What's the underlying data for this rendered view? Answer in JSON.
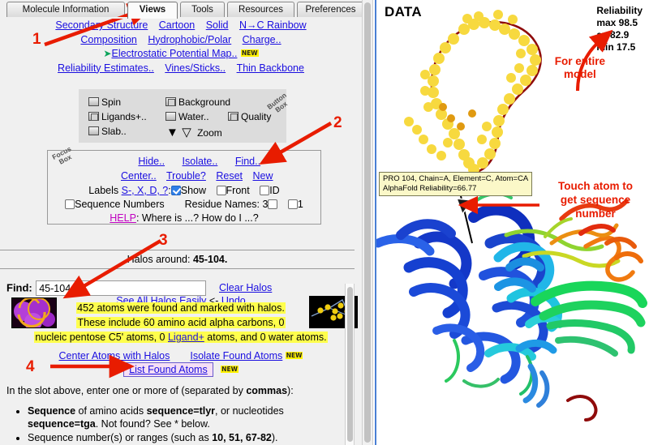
{
  "tabs": [
    {
      "label": "Molecule Information",
      "active": false
    },
    {
      "label": "Views",
      "active": true
    },
    {
      "label": "Tools",
      "active": false
    },
    {
      "label": "Resources",
      "active": false
    },
    {
      "label": "Preferences",
      "active": false
    }
  ],
  "views_links": {
    "row1": [
      "Secondary Structure",
      "Cartoon",
      "Solid",
      "N→C Rainbow"
    ],
    "row2": [
      "Composition",
      "Hydrophobic/Polar",
      "Charge.."
    ],
    "row3_marker": "➤",
    "row3": "Electrostatic Potential Map..",
    "row3_badge": "NEW",
    "row4": [
      "Reliability Estimates..",
      "Vines/Sticks..",
      "Thin Backbone"
    ]
  },
  "button_box": {
    "title": "Button Box",
    "items": [
      {
        "label": "Spin",
        "state": "raised"
      },
      {
        "label": "Background",
        "state": "sunken"
      },
      {
        "label": "Ligands+..",
        "state": "sunken"
      },
      {
        "label": "Water..",
        "state": "raised"
      },
      {
        "label": "Quality",
        "state": "sunken"
      },
      {
        "label": "Slab..",
        "state": "raised"
      },
      {
        "label": "Zoom",
        "state": "arrows"
      }
    ],
    "zoom_label": "Zoom"
  },
  "focus_box": {
    "title": "Focus Box",
    "row1": [
      "Hide..",
      "Isolate..",
      "Find.."
    ],
    "row2": [
      "Center..",
      "Trouble?",
      "Reset",
      "New"
    ],
    "labels_prefix": "Labels ",
    "labels_links": "S-, X, D, ?",
    "labels_colon": ":",
    "show": "Show",
    "show_checked": true,
    "front": "Front",
    "front_checked": false,
    "id": "ID",
    "id_checked": false,
    "sequence_numbers": "Sequence Numbers",
    "sequence_numbers_checked": false,
    "residue_names": "Residue Names: 3",
    "residue_one": "1",
    "help_word": "HELP",
    "help_rest": ": Where is ...? How do I ...?"
  },
  "halos_bar": {
    "prefix": "Halos around: ",
    "value": "45-104."
  },
  "find": {
    "label": "Find:",
    "value": "45-104",
    "placeholder": "",
    "clear_halos": "Clear Halos",
    "see_all": "See All Halos Easily",
    "arrow": " <- ",
    "undo": "Undo"
  },
  "results": {
    "line1": "452 atoms were found and marked with halos.",
    "line2": "These include 60 amino acid alpha carbons, 0",
    "line3_a": "nucleic pentose C5' atoms, 0 ",
    "line3_link": "Ligand+",
    "line3_b": " atoms, and 0 water atoms.",
    "center_atoms": "Center Atoms with Halos",
    "isolate_found": "Isolate Found Atoms",
    "isolate_badge": "NEW",
    "list_found": "List Found Atoms",
    "list_badge": "NEW"
  },
  "instructions": {
    "intro_a": "In the slot above, enter one or more of (separated by ",
    "intro_bold": "commas",
    "intro_b": "):",
    "bullet1_a": "Sequence",
    "bullet1_b": " of amino acids ",
    "bullet1_c": "sequence=tlyr",
    "bullet1_d": ", or nucleotides ",
    "bullet1_e": "sequence=tga",
    "bullet1_f": ". Not found? See * below.",
    "bullet2_a": "Sequence number(s) or ranges (such as ",
    "bullet2_b": "10, 51, 67-82",
    "bullet2_c": ")."
  },
  "viewer": {
    "data_label": "DATA",
    "reliability": [
      "Reliability",
      "max 98.5",
      "av 82.9",
      "min 17.5"
    ],
    "for_entire_model": [
      "For entire",
      "model"
    ],
    "touch_note": [
      "Touch atom to",
      "get sequence",
      "number"
    ],
    "tooltip_line1": "PRO 104, Chain=A, Element=C, Atom=CA",
    "tooltip_line2": "AlphaFold Reliability=66.77"
  },
  "annotations": [
    {
      "number": "1"
    },
    {
      "number": "2"
    },
    {
      "number": "3"
    },
    {
      "number": "4"
    }
  ],
  "colors": {
    "link": "#1a0ee0",
    "annotation_red": "#e81c00",
    "highlight_yellow": "#ffff4d",
    "help_magenta": "#c000c0",
    "panel_border_blue": "#4a7fd4"
  }
}
